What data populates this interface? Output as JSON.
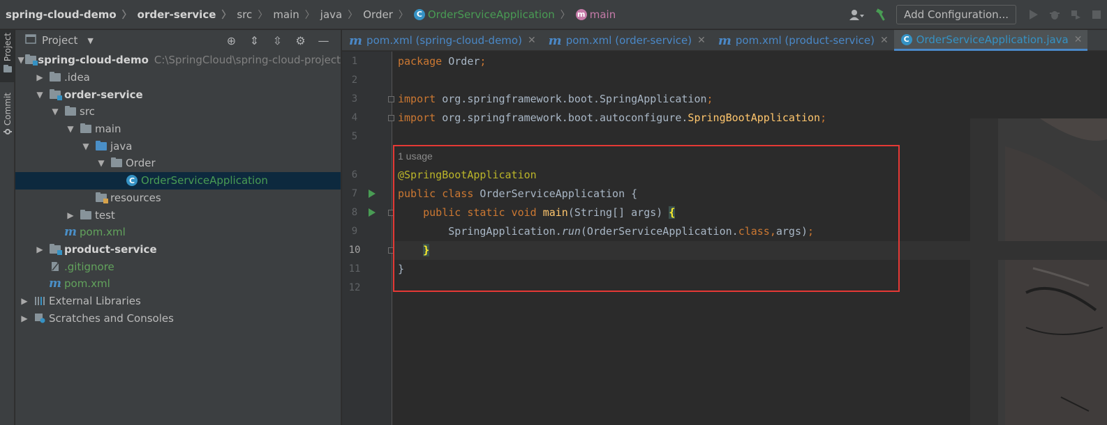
{
  "breadcrumbs": {
    "project": "spring-cloud-demo",
    "module": "order-service",
    "src": "src",
    "main": "main",
    "java": "java",
    "package": "Order",
    "class": "OrderServiceApplication",
    "method": "main"
  },
  "toolbar": {
    "add_configuration": "Add Configuration..."
  },
  "tool_strip": {
    "project_label": "Project",
    "commit_label": "Commit"
  },
  "project_panel": {
    "title": "Project",
    "tree": [
      {
        "label": "spring-cloud-demo",
        "path": "C:\\SpringCloud\\spring-cloud-project"
      },
      {
        "label": ".idea"
      },
      {
        "label": "order-service"
      },
      {
        "label": "src"
      },
      {
        "label": "main"
      },
      {
        "label": "java"
      },
      {
        "label": "Order"
      },
      {
        "label": "OrderServiceApplication"
      },
      {
        "label": "resources"
      },
      {
        "label": "test"
      },
      {
        "label": "pom.xml"
      },
      {
        "label": "product-service"
      },
      {
        "label": ".gitignore"
      },
      {
        "label": "pom.xml"
      },
      {
        "label": "External Libraries"
      },
      {
        "label": "Scratches and Consoles"
      }
    ]
  },
  "tabs": [
    {
      "label": "pom.xml (spring-cloud-demo)"
    },
    {
      "label": "pom.xml (order-service)"
    },
    {
      "label": "pom.xml (product-service)"
    },
    {
      "label": "OrderServiceApplication.java"
    }
  ],
  "editor": {
    "line_numbers": [
      "1",
      "2",
      "3",
      "4",
      "5",
      "6",
      "7",
      "8",
      "9",
      "10",
      "11",
      "12"
    ],
    "usage_hint": "1 usage",
    "code": {
      "l1_kw": "package",
      "l1_rest": " Order",
      "l1_semi": ";",
      "l3_kw": "import",
      "l3_rest": " org.springframework.boot.SpringApplication",
      "l3_semi": ";",
      "l4_kw": "import",
      "l4_rest": " org.springframework.boot.autoconfigure.",
      "l4_cls": "SpringBootApplication",
      "l4_semi": ";",
      "l6_ann": "@SpringBootApplication",
      "l7_kw": "public class",
      "l7_rest": " OrderServiceApplication {",
      "l8_kw": "public static void",
      "l8_fn": "main",
      "l8_rest": "(String[] args) ",
      "l8_brace": "{",
      "l9_a": "SpringApplication.",
      "l9_run": "run",
      "l9_b": "(OrderServiceApplication.",
      "l9_kw": "class,",
      "l9_c": "args)",
      "l9_semi": ";",
      "l10_brace": "}",
      "l11": "}"
    }
  }
}
